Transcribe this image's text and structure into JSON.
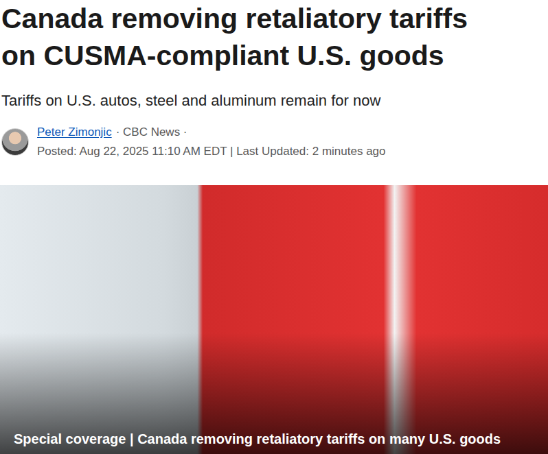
{
  "article": {
    "headline": "Canada removing retaliatory tariffs on CUSMA-compliant U.S. goods",
    "subheadline": "Tariffs on U.S. autos, steel and aluminum remain for now",
    "author": {
      "name": "Peter Zimonjic",
      "outlet": "· CBC News ·"
    },
    "meta": "Posted: Aug 22, 2025 11:10 AM EDT | Last Updated: 2 minutes ago",
    "photo": {
      "caption": "Special coverage | Canada removing retaliatory tariffs on many U.S. goods"
    }
  }
}
